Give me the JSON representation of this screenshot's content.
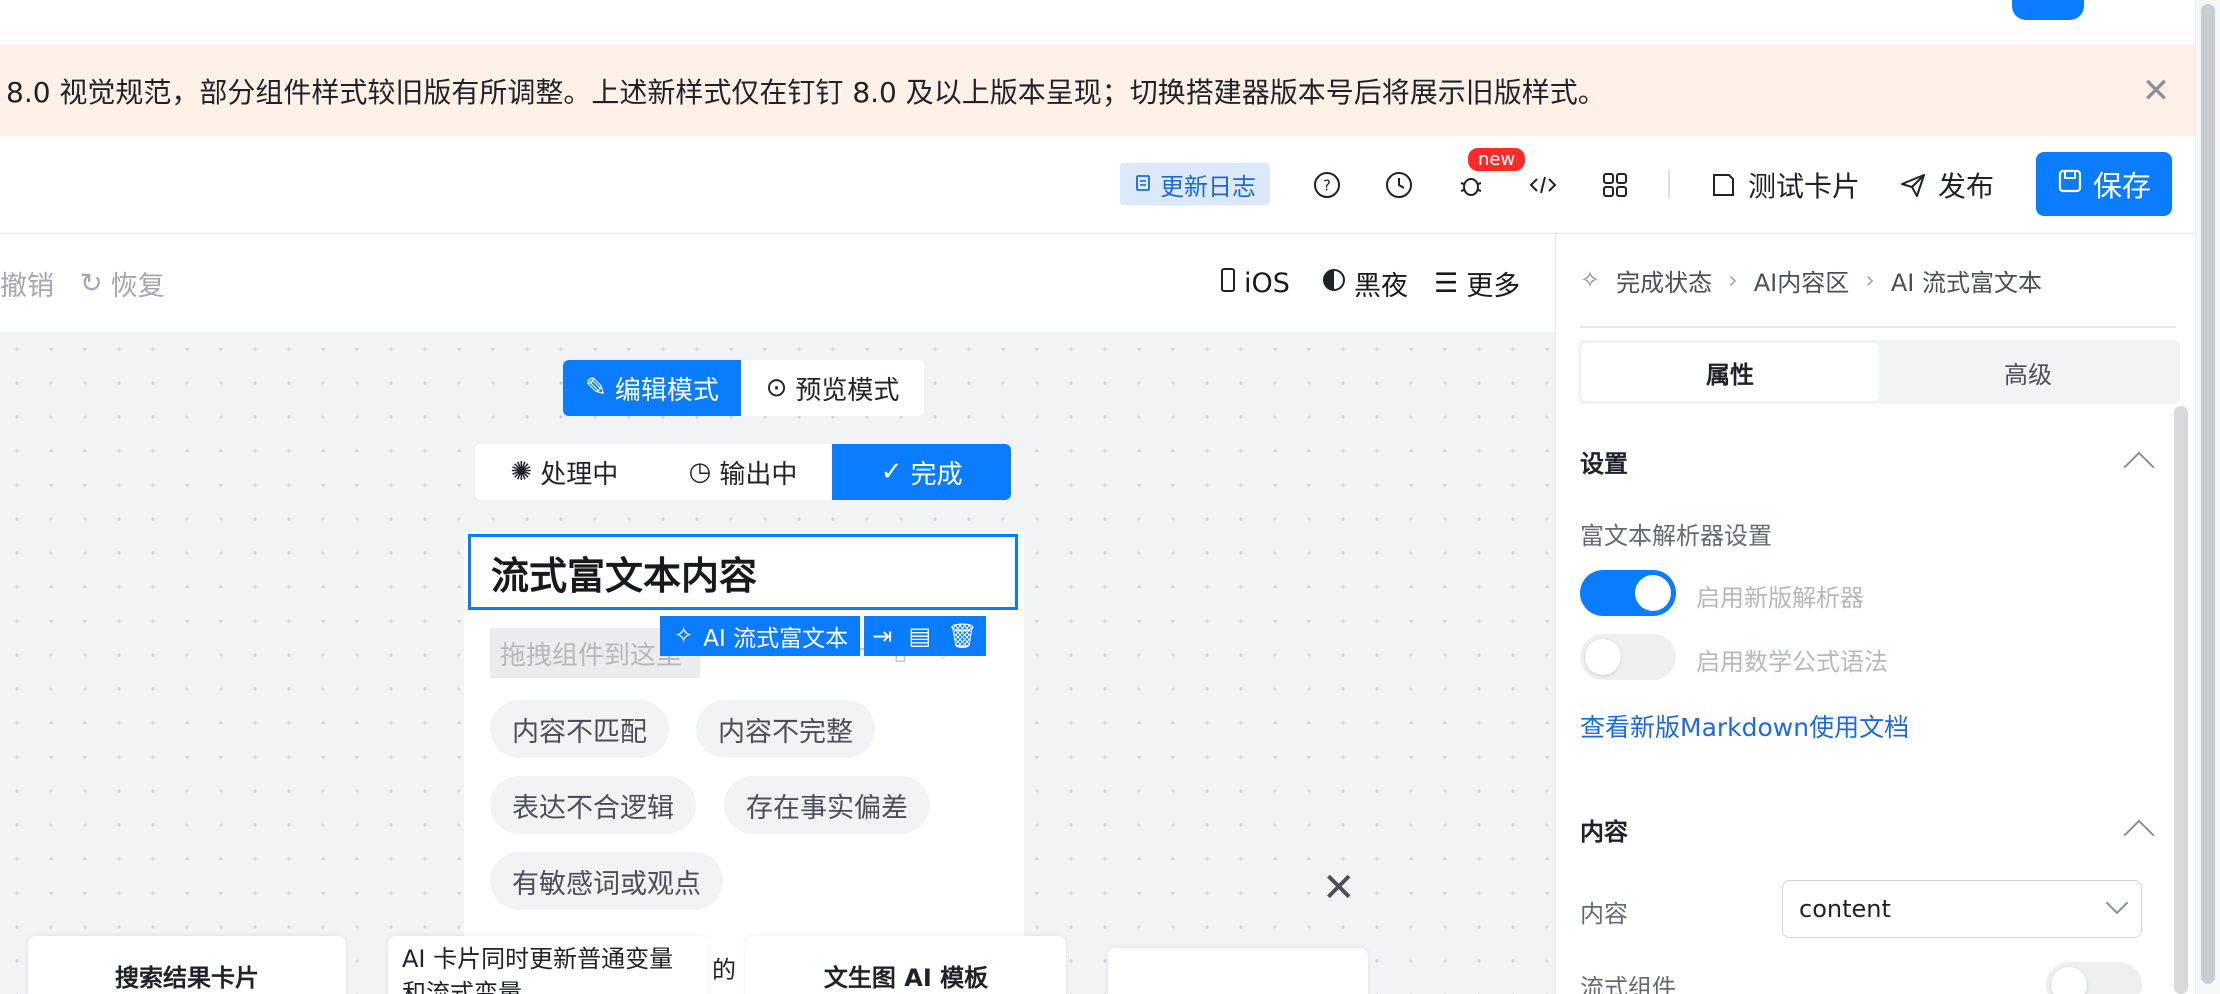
{
  "notice": {
    "text": "8.0 视觉规范，部分组件样式较旧版有所调整。上述新样式仅在钉钉 8.0 及以上版本呈现；切换搭建器版本号后将展示旧版样式。"
  },
  "toolbar": {
    "changelog": "更新日志",
    "new_badge": "new",
    "test_card": "测试卡片",
    "publish": "发布",
    "save": "保存"
  },
  "canvas_head": {
    "undo": "撤销",
    "redo": "恢复",
    "ios": "iOS",
    "dark": "黑夜",
    "more": "更多"
  },
  "mode": {
    "edit": "编辑模式",
    "preview": "预览模式"
  },
  "states": {
    "processing": "处理中",
    "outputting": "输出中",
    "done": "完成"
  },
  "card": {
    "title": "流式富文本内容",
    "drop_hint": "拖拽组件到这里",
    "selected_label": "AI 流式富文本",
    "chips": [
      "内容不匹配",
      "内容不完整",
      "表达不合逻辑",
      "存在事实偏差",
      "有敏感词或观点"
    ]
  },
  "templates": {
    "t1": "搜索结果卡片",
    "t2_line1": "AI 卡片同时更新普通变量",
    "t2_line2": "和流式变量",
    "t2_suffix": "的",
    "t3": "文生图 AI 模板"
  },
  "panel": {
    "crumbs": [
      "完成状态",
      "AI内容区",
      "AI 流式富文本"
    ],
    "tabs": [
      "属性",
      "高级"
    ],
    "settings_title": "设置",
    "parser_label": "富文本解析器设置",
    "new_parser": "启用新版解析器",
    "math_syntax": "启用数学公式语法",
    "doc_link": "查看新版Markdown使用文档",
    "content_title": "内容",
    "content_label": "内容",
    "content_value": "content",
    "stream_label": "流式组件"
  },
  "colors": {
    "primary": "#0a7cff",
    "notice_bg": "#fff1e8",
    "badge": "#ff2a2a"
  }
}
